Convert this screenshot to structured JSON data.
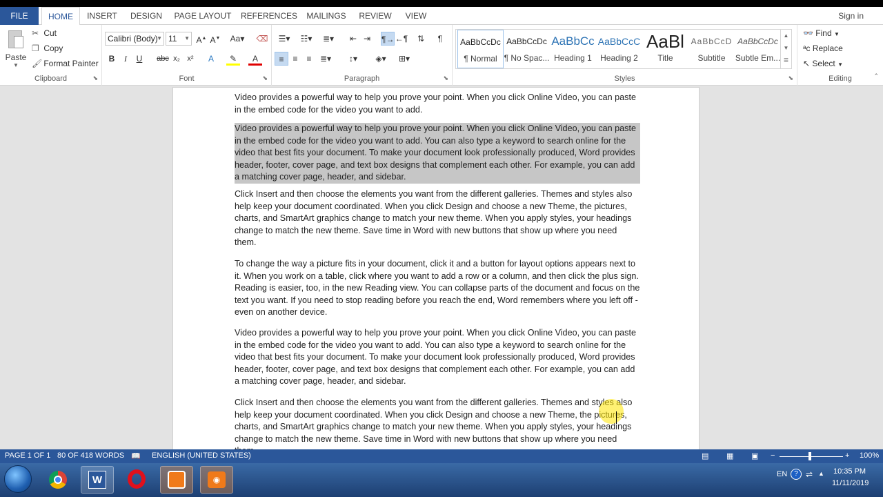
{
  "ribbon_tabs": [
    {
      "label": "FILE"
    },
    {
      "label": "HOME"
    },
    {
      "label": "INSERT"
    },
    {
      "label": "DESIGN"
    },
    {
      "label": "PAGE LAYOUT"
    },
    {
      "label": "REFERENCES"
    },
    {
      "label": "MAILINGS"
    },
    {
      "label": "REVIEW"
    },
    {
      "label": "VIEW"
    }
  ],
  "active_tab": "HOME",
  "signin": "Sign in",
  "clipboard": {
    "paste": "Paste",
    "cut": "Cut",
    "copy": "Copy",
    "format_painter": "Format Painter",
    "label": "Clipboard"
  },
  "font": {
    "name": "Calibri (Body)",
    "size": "11",
    "label": "Font"
  },
  "paragraph": {
    "label": "Paragraph"
  },
  "styles": {
    "label": "Styles",
    "items": [
      {
        "sample": "AaBbCcDc",
        "name": "¶ Normal"
      },
      {
        "sample": "AaBbCcDc",
        "name": "¶ No Spac..."
      },
      {
        "sample": "AaBbCc",
        "name": "Heading 1"
      },
      {
        "sample": "AaBbCcC",
        "name": "Heading 2"
      },
      {
        "sample": "AaBl",
        "name": "Title"
      },
      {
        "sample": "AaBbCcD",
        "name": "Subtitle"
      },
      {
        "sample": "AaBbCcDc",
        "name": "Subtle Em..."
      }
    ]
  },
  "editing": {
    "find": "Find",
    "replace": "Replace",
    "select": "Select",
    "label": "Editing"
  },
  "document": {
    "paragraphs": [
      "Video provides a powerful way to help you prove your point. When you click Online Video, you can paste in the embed code for the video you want to add.",
      "Video provides a powerful way to help you prove your point. When you click Online Video, you can paste in the embed code for the video you want to add. You can also type a keyword to search online for the video that best fits your document. To make your document look professionally produced, Word provides header, footer, cover page, and text box designs that complement each other. For example, you can add a matching cover page, header, and sidebar.",
      "Click Insert and then choose the elements you want from the different galleries. Themes and styles also help keep your document coordinated. When you click Design and choose a new Theme, the pictures, charts, and SmartArt graphics change to match your new theme. When you apply styles, your headings change to match the new theme. Save time in Word with new buttons that show up where you need them.",
      "To change the way a picture fits in your document, click it and a button for layout options appears next to it. When you work on a table, click where you want to add a row or a column, and then click the plus sign. Reading is easier, too, in the new Reading view. You can collapse parts of the document and focus on the text you want. If you need to stop reading before you reach the end, Word remembers where you left off - even on another device.",
      "Video provides a powerful way to help you prove your point. When you click Online Video, you can paste in the embed code for the video you want to add. You can also type a keyword to search online for the video that best fits your document. To make your document look professionally produced, Word provides header, footer, cover page, and text box designs that complement each other. For example, you can add a matching cover page, header, and sidebar.",
      "Click Insert and then choose the elements you want from the different galleries. Themes and styles also help keep your document coordinated. When you click Design and choose a new Theme, the pictures, charts, and SmartArt graphics change to match your new theme. When you apply styles, your headings change to match the new theme. Save time in Word with new buttons that show up where you need them."
    ],
    "highlighted_paragraph_index": 1
  },
  "status": {
    "page": "PAGE 1 OF 1",
    "words": "80 OF 418 WORDS",
    "language": "ENGLISH (UNITED STATES)",
    "zoom": "100%"
  },
  "taskbar": {
    "apps": [
      "chrome-icon",
      "word-icon",
      "opera-icon",
      "recorder-icon",
      "camera-icon"
    ],
    "lang": "EN",
    "time": "10:35 PM",
    "date": "11/11/2019"
  },
  "colors": {
    "word_blue": "#2b579a",
    "selection": "#c6c6c6",
    "cursor_highlight": "#ffe600"
  }
}
